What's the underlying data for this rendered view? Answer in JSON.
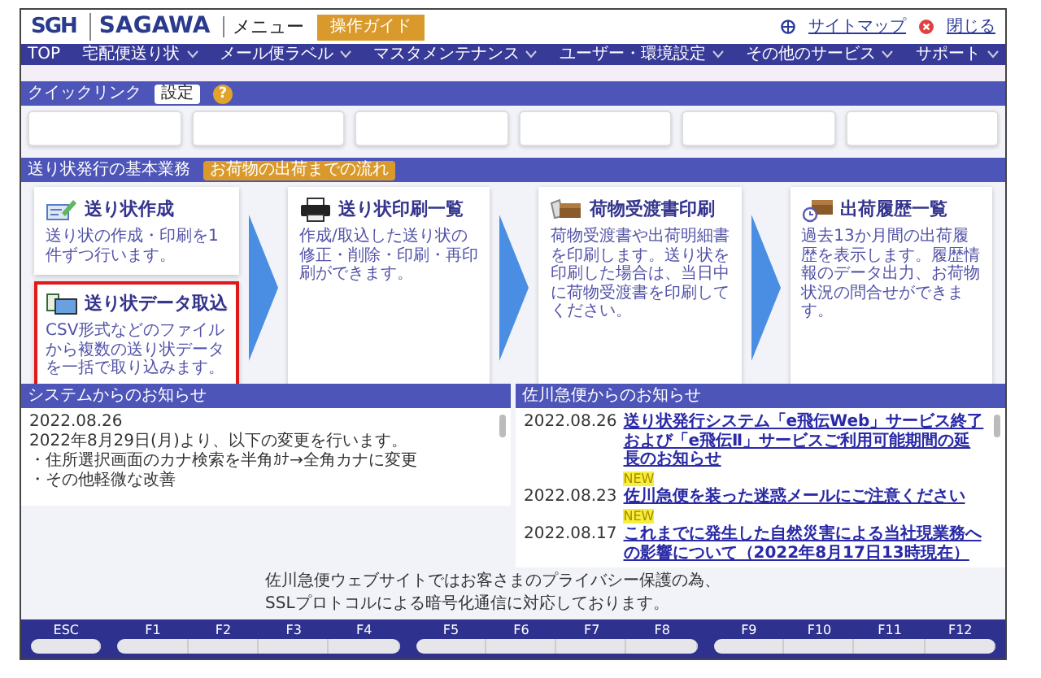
{
  "header": {
    "logo_mark": "SGH",
    "brand": "SAGAWA",
    "title": "メニュー",
    "guide_button": "操作ガイド",
    "links": [
      {
        "kind": "sitemap",
        "label": "サイトマップ"
      },
      {
        "kind": "close",
        "label": "閉じる"
      }
    ]
  },
  "nav": [
    {
      "label": "TOP",
      "dropdown": false
    },
    {
      "label": "宅配便送り状",
      "dropdown": true
    },
    {
      "label": "メール便ラベル",
      "dropdown": true
    },
    {
      "label": "マスタメンテナンス",
      "dropdown": true
    },
    {
      "label": "ユーザー・環境設定",
      "dropdown": true
    },
    {
      "label": "その他のサービス",
      "dropdown": true
    },
    {
      "label": "サポート",
      "dropdown": true
    }
  ],
  "quick_links": {
    "title": "クイックリンク",
    "settings_button": "設定",
    "help": "?"
  },
  "basic_tasks": {
    "title": "送り状発行の基本業務",
    "flow_badge": "お荷物の出荷までの流れ",
    "columns": [
      {
        "cards": [
          {
            "title": "送り状作成",
            "description": "送り状の作成・印刷を1件ずつ行います。",
            "selected": false
          },
          {
            "title": "送り状データ取込",
            "description": "CSV形式などのファイルから複数の送り状データを一括で取り込みます。",
            "selected": true
          }
        ]
      },
      {
        "cards": [
          {
            "title": "送り状印刷一覧",
            "description": "作成/取込した送り状の修正・削除・印刷・再印刷ができます。",
            "selected": false
          }
        ]
      },
      {
        "cards": [
          {
            "title": "荷物受渡書印刷",
            "description": "荷物受渡書や出荷明細書を印刷します。送り状を印刷した場合は、当日中に荷物受渡書を印刷してください。",
            "selected": false
          }
        ]
      },
      {
        "cards": [
          {
            "title": "出荷履歴一覧",
            "description": "過去13か月間の出荷履歴を表示します。履歴情報のデータ出力、お荷物状況の問合せができます。",
            "selected": false
          }
        ]
      }
    ]
  },
  "system_notices": {
    "title": "システムからのお知らせ",
    "lines": [
      "2022.08.26",
      "2022年8月29日(月)より、以下の変更を行います。",
      "・住所選択画面のカナ検索を半角ｶﾅ→全角カナに変更",
      "・その他軽微な改善"
    ]
  },
  "sagawa_notices": {
    "title": "佐川急便からのお知らせ",
    "items": [
      {
        "date": "2022.08.26",
        "link": "送り状発行システム「e飛伝Web」サービス終了および「e飛伝Ⅱ」サービスご利用可能期間の延長のお知らせ",
        "new": true,
        "new_label": "NEW"
      },
      {
        "date": "2022.08.23",
        "link": "佐川急便を装った迷惑メールにご注意ください",
        "new": true,
        "new_label": "NEW"
      },
      {
        "date": "2022.08.17",
        "link": "これまでに発生した自然災害による当社現業務への影響について（2022年8月17日13時現在）",
        "new": false
      }
    ]
  },
  "privacy_notice": [
    "佐川急便ウェブサイトではお客さまのプライバシー保護の為、",
    "SSLプロトコルによる暗号化通信に対応しております。"
  ],
  "function_keys": [
    [
      "ESC"
    ],
    [
      "F1",
      "F2",
      "F3",
      "F4"
    ],
    [
      "F5",
      "F6",
      "F7",
      "F8"
    ],
    [
      "F9",
      "F10",
      "F11",
      "F12"
    ]
  ]
}
